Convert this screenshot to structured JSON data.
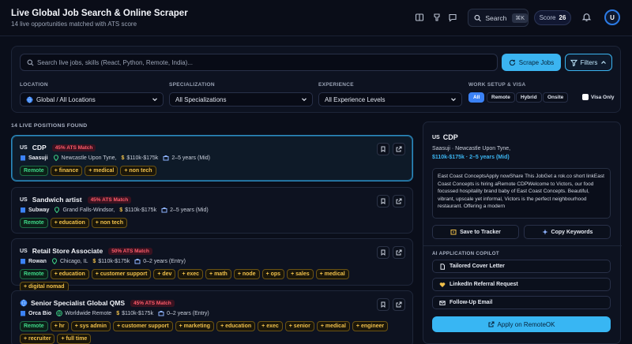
{
  "header": {
    "title": "Live Global Job Search & Online Scraper",
    "subtitle": "14 live opportunities matched with ATS score",
    "search_label": "Search",
    "search_kbd": "⌘K",
    "score_label": "Score",
    "score_value": "26",
    "avatar_initial": "U"
  },
  "filters": {
    "search_placeholder": "Search live jobs, skills (React, Python, Remote, India)...",
    "scrape_label": "Scrape Jobs",
    "filters_label": "Filters",
    "location_label": "LOCATION",
    "location_value": "Global / All Locations",
    "specialization_label": "SPECIALIZATION",
    "specialization_value": "All Specializations",
    "experience_label": "EXPERIENCE",
    "experience_value": "All Experience Levels",
    "setup_label": "WORK SETUP & VISA",
    "setup_options": [
      "All",
      "Remote",
      "Hybrid",
      "Onsite"
    ],
    "setup_active": "All",
    "visa_label": "Visa Only"
  },
  "list": {
    "heading": "14 LIVE POSITIONS FOUND",
    "jobs": [
      {
        "flag": "US",
        "title": "CDP",
        "ats": "45% ATS Match",
        "company": "Saasuji",
        "location": "Newcastle Upon Tyne,",
        "salary": "$110k-$175k",
        "experience": "2–5 years (Mid)",
        "tags": [
          "Remote",
          "+ finance",
          "+ medical",
          "+ non tech"
        ]
      },
      {
        "flag": "US",
        "title": "Sandwich artist",
        "ats": "45% ATS Match",
        "company": "Subway",
        "location": "Grand Falls-Windsor,",
        "salary": "$110k-$175k",
        "experience": "2–5 years (Mid)",
        "tags": [
          "Remote",
          "+ education",
          "+ non tech"
        ]
      },
      {
        "flag": "US",
        "title": "Retail Store Associate",
        "ats": "50% ATS Match",
        "company": "Rowan",
        "location": "Chicago, IL",
        "salary": "$110k-$175k",
        "experience": "0–2 years (Entry)",
        "tags": [
          "Remote",
          "+ education",
          "+ customer support",
          "+ dev",
          "+ exec",
          "+ math",
          "+ node",
          "+ ops",
          "+ sales",
          "+ medical",
          "+ digital nomad"
        ]
      },
      {
        "flag": "",
        "title": "Senior Specialist Global QMS",
        "ats": "45% ATS Match",
        "company": "Orca Bio",
        "location": "Worldwide Remote",
        "salary": "$110k-$175k",
        "experience": "0–2 years (Entry)",
        "tags": [
          "Remote",
          "+ hr",
          "+ sys admin",
          "+ customer support",
          "+ marketing",
          "+ education",
          "+ exec",
          "+ senior",
          "+ medical",
          "+ engineer",
          "+ recruiter",
          "+ full time"
        ]
      }
    ]
  },
  "detail": {
    "flag": "US",
    "title": "CDP",
    "company_location": "Saasuji · Newcastle Upon Tyne,",
    "salary_exp": "$110k-$175k · 2–5 years (Mid)",
    "description": "East Coast ConceptsApply nowShare This JobGet a rok.co short linkEast Coast Concepts is hiring aRemote CDPWelcome to Victors, our food focussed hospitality brand baby of East Coast Concepts. Beautiful, vibrant, upscale yet informal, Victors is the perfect neighbourhood restaurant. Offering a modern",
    "save_label": "Save to Tracker",
    "copy_label": "Copy Keywords",
    "copilot_heading": "AI APPLICATION COPILOT",
    "copilot_items": [
      "Tailored Cover Letter",
      "LinkedIn Referral Request",
      "Follow-Up Email"
    ],
    "apply_label": "Apply on RemoteOK"
  },
  "colors": {
    "accent": "#3bb4f0",
    "ats_red": "#ff5c6a",
    "tag_yellow": "#f0c04a",
    "tag_green": "#3fd989"
  }
}
